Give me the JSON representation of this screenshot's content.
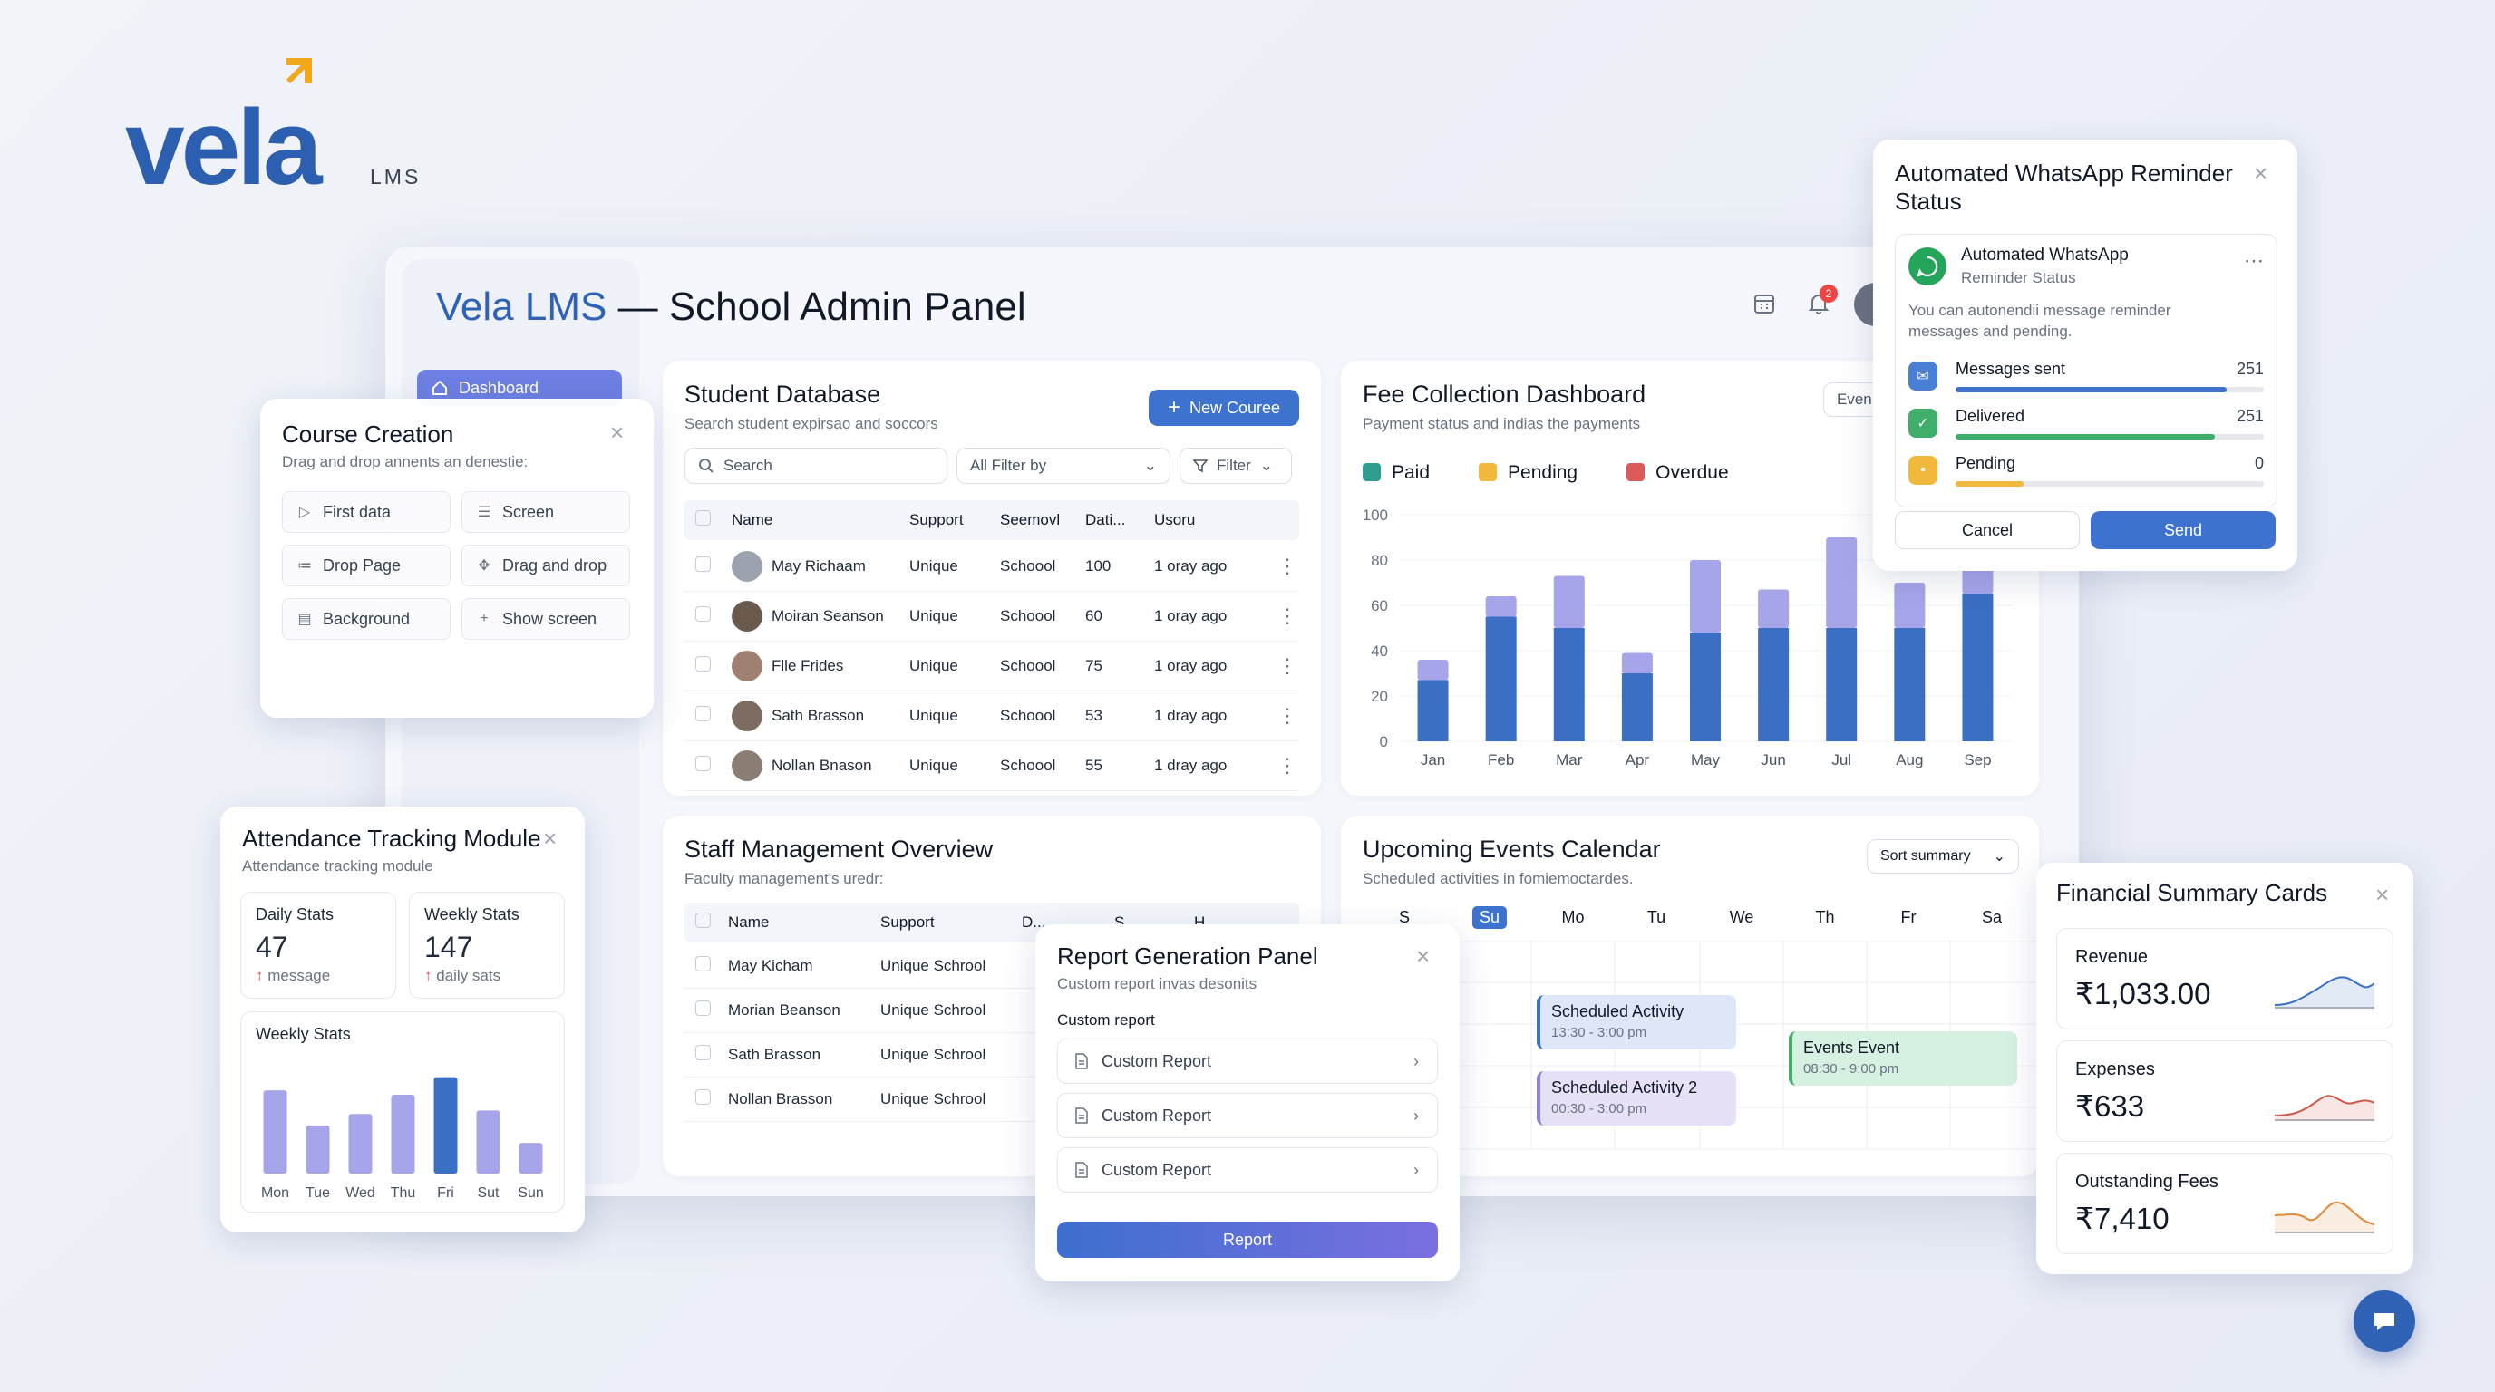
{
  "logo": {
    "word": "vela",
    "suffix": "LMS"
  },
  "panel": {
    "brand": "Vela LMS",
    "title_rest": " — School Admin Panel",
    "notification_count": "2",
    "sidebar_active": "Dashboard"
  },
  "student_db": {
    "title": "Student Database",
    "subtitle": "Search student expirsao and soccors",
    "new_button": "New Couree",
    "search_placeholder": "Search",
    "filter_select": "All Filter by",
    "filter_button": "Filter",
    "columns": [
      "Name",
      "Support",
      "Seemovl",
      "Dati...",
      "Usoru"
    ],
    "rows": [
      {
        "name": "May Richaam",
        "support": "Unique",
        "school": "Schoool",
        "num": "100",
        "time": "1 oray ago"
      },
      {
        "name": "Moiran Seanson",
        "support": "Unique",
        "school": "Schoool",
        "num": "60",
        "time": "1 oray ago"
      },
      {
        "name": "Flle Frides",
        "support": "Unique",
        "school": "Schoool",
        "num": "75",
        "time": "1 oray ago"
      },
      {
        "name": "Sath Brasson",
        "support": "Unique",
        "school": "Schoool",
        "num": "53",
        "time": "1 dray ago"
      },
      {
        "name": "Nollan Bnason",
        "support": "Unique",
        "school": "Schoool",
        "num": "55",
        "time": "1 dray ago"
      }
    ]
  },
  "fee": {
    "title": "Fee Collection Dashboard",
    "subtitle": "Payment status and indias the payments",
    "corner_button": "Even",
    "legend": [
      {
        "label": "Paid",
        "color": "#2f9e8f"
      },
      {
        "label": "Pending",
        "color": "#f0b83c"
      },
      {
        "label": "Overdue",
        "color": "#dc5a5a"
      }
    ]
  },
  "chart_data": {
    "type": "bar",
    "categories": [
      "Jan",
      "Feb",
      "Mar",
      "Apr",
      "May",
      "Jun",
      "Jul",
      "Aug",
      "Sep"
    ],
    "series": [
      {
        "values": [
          27,
          55,
          50,
          30,
          48,
          50,
          50,
          50,
          65
        ]
      },
      {
        "values": [
          9,
          9,
          23,
          9,
          32,
          17,
          40,
          20,
          17
        ]
      }
    ],
    "ylim": [
      0,
      100
    ],
    "yticks": [
      0,
      20,
      40,
      60,
      80,
      100
    ],
    "colors": [
      "#3a6fc4",
      "#a7a5ea"
    ]
  },
  "course": {
    "title": "Course Creation",
    "subtitle": "Drag and drop annents an denestie:",
    "items": [
      {
        "label": "First data",
        "icon": "▷"
      },
      {
        "label": "Screen",
        "icon": "☰"
      },
      {
        "label": "Drop Page",
        "icon": "≔"
      },
      {
        "label": "Drag and drop",
        "icon": "✥"
      },
      {
        "label": "Background",
        "icon": "▤"
      },
      {
        "label": "Show screen",
        "icon": "+"
      }
    ]
  },
  "attendance": {
    "title": "Attendance Tracking Module",
    "subtitle": "Attendance tracking module",
    "daily": {
      "label": "Daily Stats",
      "value": "47",
      "note": "message"
    },
    "weekly": {
      "label": "Weekly Stats",
      "value": "147",
      "note": "daily sats"
    },
    "chart_title": "Weekly Stats",
    "days": [
      "Mon",
      "Tue",
      "Wed",
      "Thu",
      "Fri",
      "Sut",
      "Sun"
    ],
    "values": [
      95,
      55,
      68,
      90,
      110,
      72,
      35
    ],
    "highlight_index": 4
  },
  "staff": {
    "title": "Staff Management Overview",
    "subtitle": "Faculty management's uredr:",
    "columns": [
      "Name",
      "Support",
      "D...",
      "S...",
      "H..."
    ],
    "rows": [
      {
        "name": "May Kicham",
        "support": "Unique Schrool"
      },
      {
        "name": "Morian Beanson",
        "support": "Unique Schrool"
      },
      {
        "name": "Sath Brasson",
        "support": "Unique Schrool"
      },
      {
        "name": "Nollan Brasson",
        "support": "Unique Schrool"
      }
    ]
  },
  "events": {
    "title": "Upcoming Events Calendar",
    "subtitle": "Scheduled activities in fomiemoctardes.",
    "sort_button": "Sort summary",
    "days": [
      "S",
      "Su",
      "Mo",
      "Tu",
      "We",
      "Th",
      "Fr",
      "Sa"
    ],
    "active_day": "Su",
    "items": [
      {
        "title": "Scheduled Activity",
        "time": "13:30 - 3:00 pm"
      },
      {
        "title": "Scheduled Activity 2",
        "time": "00:30 - 3:00 pm"
      },
      {
        "title": "Events Event",
        "time": "08:30 - 9:00 pm"
      }
    ]
  },
  "whatsapp": {
    "title": "Automated WhatsApp Reminder Status",
    "card_title": "Automated WhatsApp",
    "card_subtitle": "Reminder Status",
    "description": "You can autonendii message reminder messages and pending.",
    "rows": [
      {
        "label": "Messages sent",
        "value": "251",
        "fill": 0.88,
        "color": "#3d73cf",
        "icon": "✉",
        "icon_bg": "#4a7fd6"
      },
      {
        "label": "Delivered",
        "value": "251",
        "fill": 0.84,
        "color": "#3fae6a",
        "icon": "✓",
        "icon_bg": "#3fae6a"
      },
      {
        "label": "Pending",
        "value": "0",
        "fill": 0.22,
        "color": "#f0b83c",
        "icon": "•",
        "icon_bg": "#f0b83c"
      }
    ],
    "cancel": "Cancel",
    "send": "Send"
  },
  "report": {
    "title": "Report Generation Panel",
    "subtitle": "Custom report invas desonits",
    "section": "Custom report",
    "items": [
      "Custom Report",
      "Custom Report",
      "Custom Report"
    ],
    "button": "Report"
  },
  "financial": {
    "title": "Financial Summary Cards",
    "cards": [
      {
        "label": "Revenue",
        "value": "₹1,033.00",
        "color": "#3a6fc4"
      },
      {
        "label": "Expenses",
        "value": "₹633",
        "color": "#d05a4a"
      },
      {
        "label": "Outstanding Fees",
        "value": "₹7,410",
        "color": "#e08a3a"
      }
    ]
  }
}
